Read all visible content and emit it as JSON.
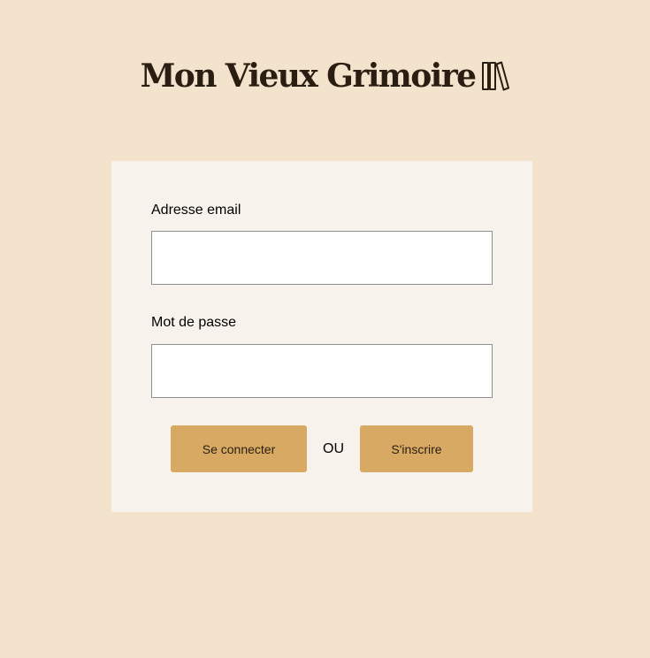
{
  "header": {
    "logo_text": "Mon Vieux Grimoire",
    "logo_icon": "books-icon"
  },
  "login_form": {
    "email_label": "Adresse email",
    "email_value": "",
    "password_label": "Mot de passe",
    "password_value": "",
    "login_button": "Se connecter",
    "separator": "OU",
    "signup_button": "S'inscrire"
  },
  "colors": {
    "page_background": "#f3e3cc",
    "card_background": "#f8f2ec",
    "button_background": "#d8a963",
    "logo_color": "#2a1e13"
  }
}
